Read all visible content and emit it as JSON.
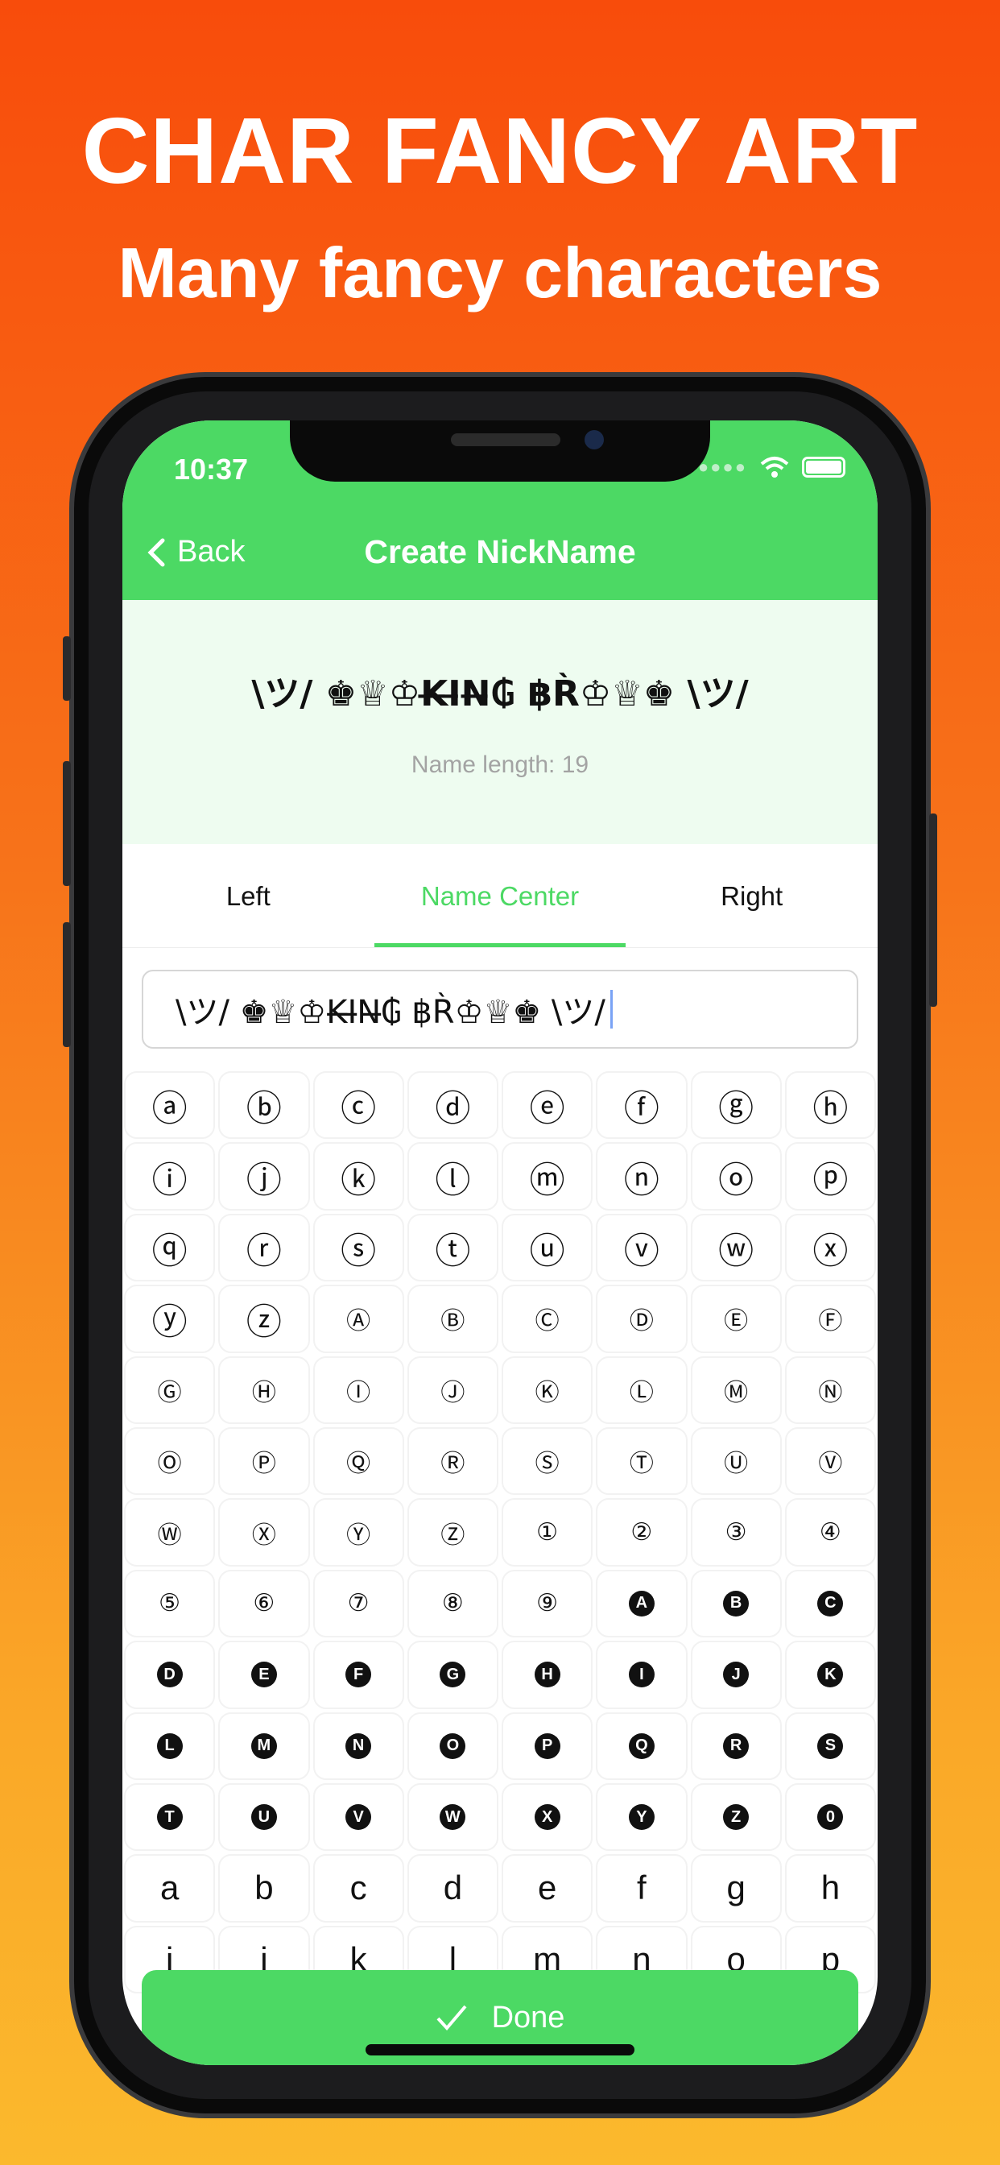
{
  "promo": {
    "title": "CHAR FANCY ART",
    "subtitle": "Many fancy characters"
  },
  "colors": {
    "accent": "#4cd964",
    "preview_bg": "#eefcf0",
    "bg_top": "#f84c0b",
    "bg_bottom": "#fbb92d"
  },
  "status": {
    "time": "10:37",
    "icons": [
      "wifi-icon",
      "battery-icon"
    ]
  },
  "nav": {
    "back_label": "Back",
    "title": "Create NickName",
    "back_icon": "chevron-left-icon"
  },
  "preview": {
    "name": "\\ツ/ ♚♕♔K̶I̶N̶₲ ฿R̀♔♕♚ \\ツ/",
    "length_label": "Name length: 19"
  },
  "tabs": [
    {
      "label": "Left",
      "active": false
    },
    {
      "label": "Name Center",
      "active": true
    },
    {
      "label": "Right",
      "active": false
    }
  ],
  "input": {
    "value": "\\ツ/ ♚♕♔K̶I̶N̶₲ ฿R̀♔♕♚ \\ツ/"
  },
  "grid": {
    "circled_lower": [
      "ⓐ",
      "ⓑ",
      "ⓒ",
      "ⓓ",
      "ⓔ",
      "ⓕ",
      "ⓖ",
      "ⓗ",
      "ⓘ",
      "ⓙ",
      "ⓚ",
      "ⓛ",
      "ⓜ",
      "ⓝ",
      "ⓞ",
      "ⓟ",
      "ⓠ",
      "ⓡ",
      "ⓢ",
      "ⓣ",
      "ⓤ",
      "ⓥ",
      "ⓦ",
      "ⓧ",
      "ⓨ",
      "ⓩ"
    ],
    "circled_upper": [
      "Ⓐ",
      "Ⓑ",
      "Ⓒ",
      "Ⓓ",
      "Ⓔ",
      "Ⓕ",
      "Ⓖ",
      "Ⓗ",
      "Ⓘ",
      "Ⓙ",
      "Ⓚ",
      "Ⓛ",
      "Ⓜ",
      "Ⓝ",
      "Ⓞ",
      "Ⓟ",
      "Ⓠ",
      "Ⓡ",
      "Ⓢ",
      "Ⓣ",
      "Ⓤ",
      "Ⓥ",
      "Ⓦ",
      "Ⓧ",
      "Ⓨ",
      "Ⓩ"
    ],
    "circled_digits": [
      "①",
      "②",
      "③",
      "④",
      "⑤",
      "⑥",
      "⑦",
      "⑧",
      "⑨"
    ],
    "negative_circled": [
      "A",
      "B",
      "C",
      "D",
      "E",
      "F",
      "G",
      "H",
      "I",
      "J",
      "K",
      "L",
      "M",
      "N",
      "O",
      "P",
      "Q",
      "R",
      "S",
      "T",
      "U",
      "V",
      "W",
      "X",
      "Y",
      "Z",
      "0"
    ],
    "plain": [
      "a",
      "b",
      "c",
      "d",
      "e",
      "f",
      "g",
      "h",
      "i",
      "j",
      "k",
      "l",
      "m",
      "n",
      "o",
      "p"
    ]
  },
  "done": {
    "label": "Done",
    "icon": "checkmark-icon"
  }
}
